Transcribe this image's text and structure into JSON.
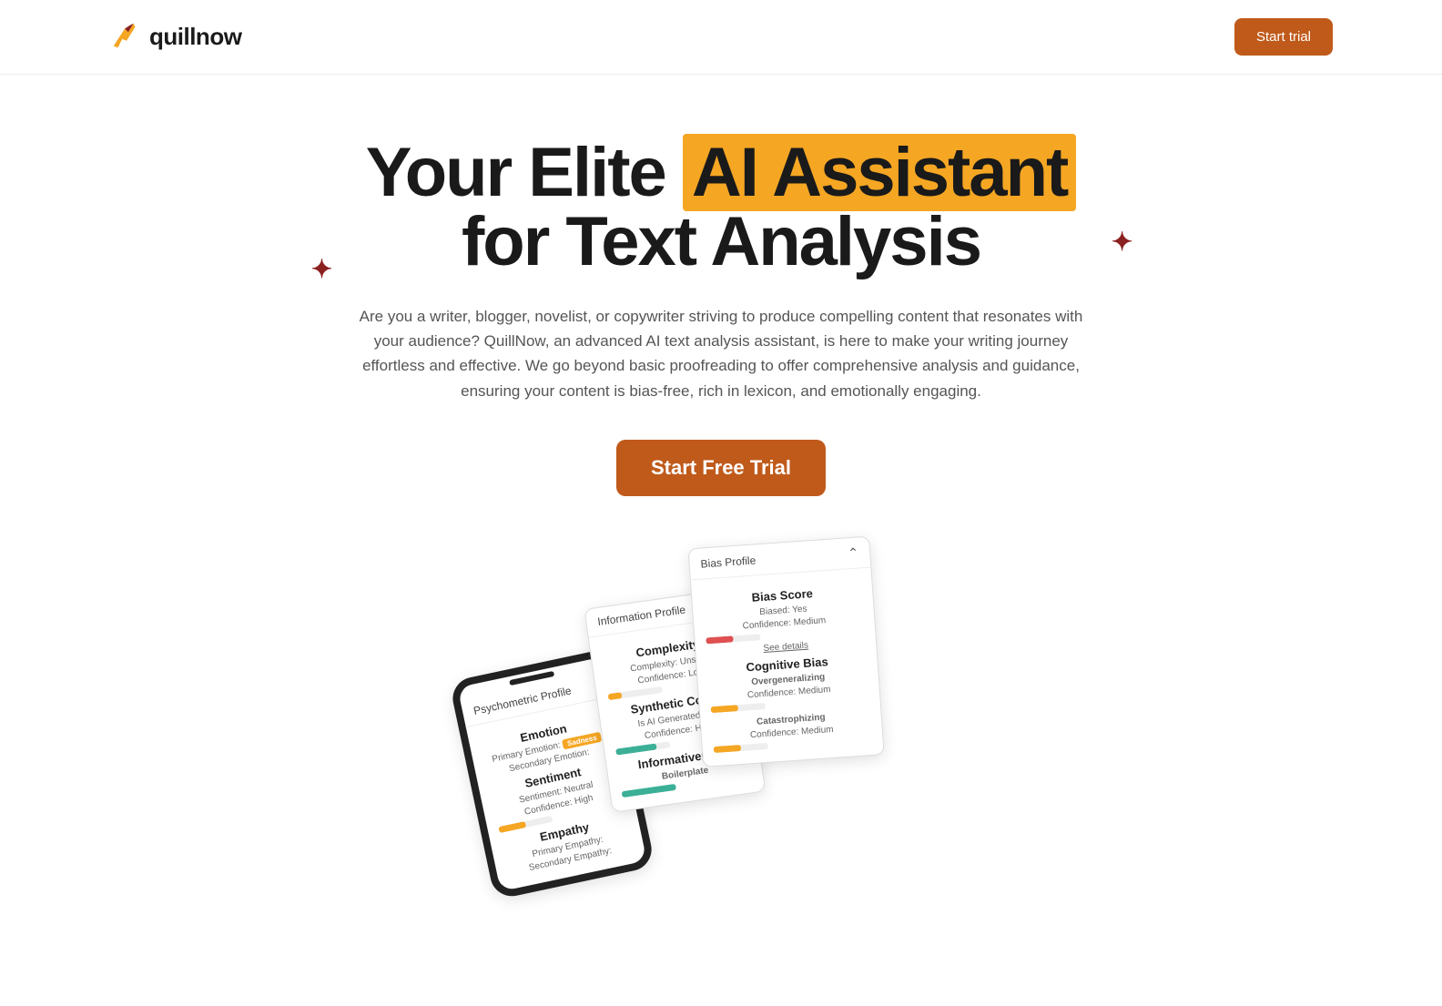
{
  "header": {
    "brand": "quillnow",
    "trial_label": "Start trial"
  },
  "hero": {
    "headline_pre": "Your Elite ",
    "headline_highlight": "AI Assistant",
    "headline_post": " for Text Analysis",
    "subtext": "Are you a writer, blogger, novelist, or copywriter striving to produce compelling content that resonates with your audience? QuillNow, an advanced AI text analysis assistant, is here to make your writing journey effortless and effective. We go beyond basic proofreading to offer comprehensive analysis and guidance, ensuring your content is bias-free, rich in lexicon, and emotionally engaging.",
    "cta_label": "Start Free Trial"
  },
  "mockup": {
    "card1": {
      "title": "Psychometric Profile",
      "emotion_h": "Emotion",
      "emotion_primary": "Primary Emotion:",
      "emotion_primary_badge": "Sadness",
      "emotion_secondary": "Secondary Emotion:",
      "sentiment_h": "Sentiment",
      "sentiment_val": "Sentiment: Neutral",
      "sentiment_conf": "Confidence: High",
      "empathy_h": "Empathy",
      "empathy_primary": "Primary Empathy:",
      "empathy_secondary": "Secondary Empathy:"
    },
    "card2": {
      "title": "Information Profile",
      "complexity_h": "Complexity",
      "complexity_val": "Complexity: Unsure",
      "complexity_conf": "Confidence: Low",
      "synth_h": "Synthetic Conte",
      "synth_val": "Is AI Generated: No",
      "synth_conf": "Confidence: High",
      "info_h": "Informativeness",
      "info_sub": "Boilerplate"
    },
    "card3": {
      "title": "Bias Profile",
      "score_h": "Bias Score",
      "biased": "Biased: Yes",
      "conf_medium": "Confidence: Medium",
      "see_details": "See details",
      "cog_h": "Cognitive Bias",
      "overgen": "Overgeneralizing",
      "catas": "Catastrophizing"
    }
  },
  "colors": {
    "accent": "#c05a1a",
    "highlight": "#f5a623"
  }
}
